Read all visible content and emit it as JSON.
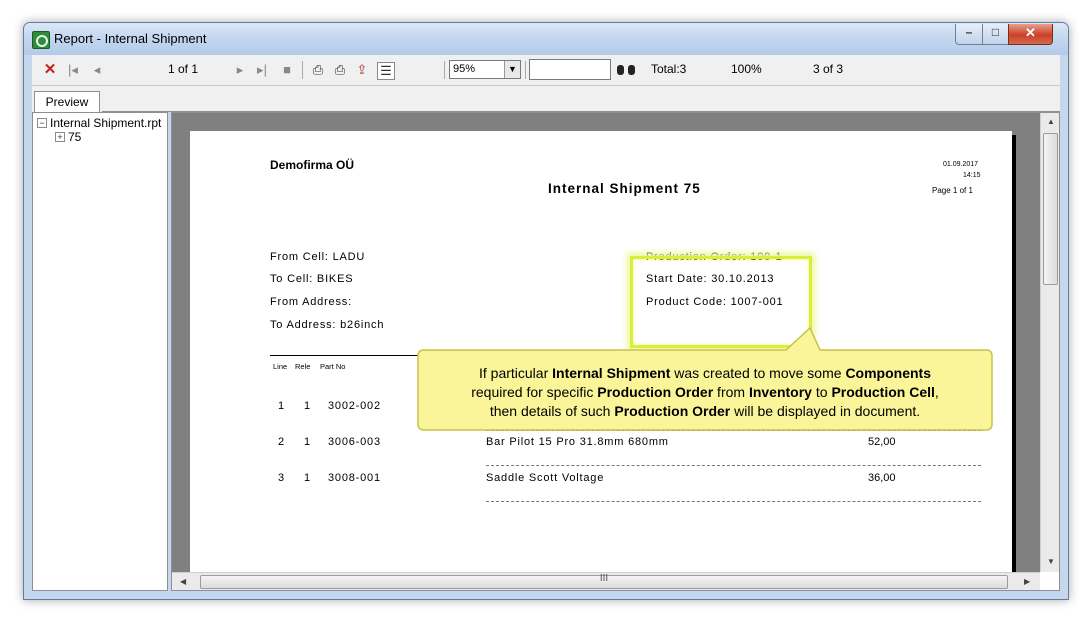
{
  "window": {
    "title": "Report - Internal Shipment",
    "minimize": "–",
    "maximize": "□",
    "close": "✕"
  },
  "toolbar": {
    "close_icon": "close-x-icon",
    "page_info": "1 of 1",
    "zoom": "95%",
    "search_value": "",
    "total": "Total:3",
    "percent": "100%",
    "records": "3 of 3"
  },
  "tabs": [
    "Preview"
  ],
  "tree": {
    "root": "Internal Shipment.rpt",
    "child": "75"
  },
  "report": {
    "company": "Demofirma OÜ",
    "title": "Internal Shipment 75",
    "date": "01.09.2017",
    "time": "14:15",
    "page": "Page 1 of 1",
    "from_cell": "From Cell: LADU",
    "to_cell": "To Cell: BIKES",
    "from_address": "From Address:",
    "to_address": "To Address: b26inch",
    "production_order": "Production Order: 100-1",
    "start_date": "Start Date: 30.10.2013",
    "product_code": "Product Code: 1007-001",
    "columns": [
      "Line",
      "Rele",
      "Part No"
    ],
    "rows": [
      {
        "line": "1",
        "rele": "1",
        "part": "3002-002",
        "desc": "",
        "qty": ""
      },
      {
        "line": "2",
        "rele": "1",
        "part": "3006-003",
        "desc": "Bar Pilot 15 Pro 31.8mm 680mm",
        "qty": "52,00"
      },
      {
        "line": "3",
        "rele": "1",
        "part": "3008-001",
        "desc": "Saddle Scott Voltage",
        "qty": "36,00"
      }
    ]
  },
  "callout": {
    "line1_a": "If particular ",
    "line1_b": "Internal Shipment",
    "line1_c": " was created to move some ",
    "line1_d": "Components",
    "line2_a": "required for specific ",
    "line2_b": "Production Order",
    "line2_c": " from ",
    "line2_d": "Inventory",
    "line2_e": " to ",
    "line2_f": "Production Cell",
    "line2_g": ",",
    "line3_a": "then details of such ",
    "line3_b": "Production Order",
    "line3_c": " will be displayed in document."
  },
  "scrollbar": {
    "grip": "III"
  },
  "colors": {
    "highlight": "#d8ee38",
    "callout_fill": "#fbf59a",
    "callout_border": "#c8c14a"
  }
}
